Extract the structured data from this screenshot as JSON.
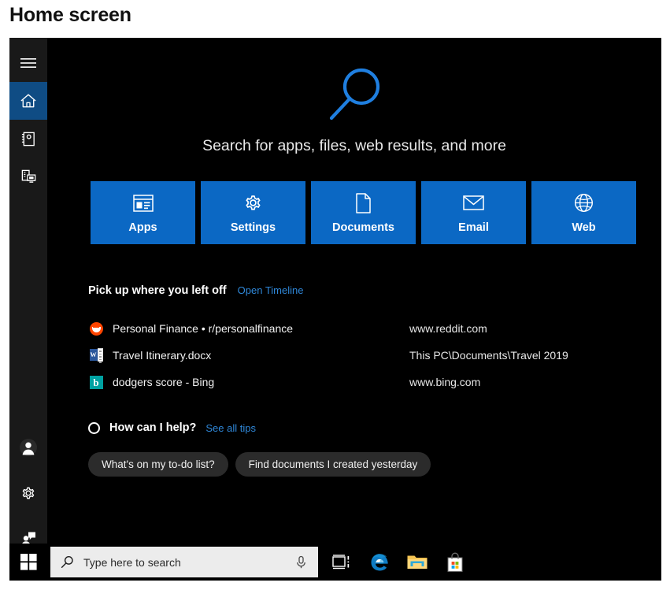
{
  "page": {
    "heading": "Home screen"
  },
  "rail": {
    "top_items": [
      {
        "name": "hamburger-menu",
        "label": "Menu",
        "active": false
      },
      {
        "name": "home",
        "label": "Home",
        "active": true
      },
      {
        "name": "notebook",
        "label": "Notebook",
        "active": false
      },
      {
        "name": "devices",
        "label": "Devices",
        "active": false
      }
    ],
    "bottom_items": [
      {
        "name": "account",
        "label": "Account"
      },
      {
        "name": "settings",
        "label": "Settings"
      },
      {
        "name": "feedback",
        "label": "Feedback"
      }
    ]
  },
  "hero": {
    "icon": "search-magnifier-icon",
    "tagline": "Search for apps, files, web results, and more",
    "accent_color": "#1f7fe0"
  },
  "tiles": [
    {
      "label": "Apps",
      "icon": "apps-window-icon"
    },
    {
      "label": "Settings",
      "icon": "gear-icon"
    },
    {
      "label": "Documents",
      "icon": "document-page-icon"
    },
    {
      "label": "Email",
      "icon": "envelope-icon"
    },
    {
      "label": "Web",
      "icon": "globe-icon"
    }
  ],
  "tile_color": "#0b68c4",
  "timeline": {
    "title": "Pick up where you left off",
    "link": "Open Timeline",
    "items": [
      {
        "icon": "reddit-icon",
        "title": "Personal Finance • r/personalfinance",
        "source": "www.reddit.com"
      },
      {
        "icon": "word-doc-icon",
        "title": "Travel Itinerary.docx",
        "source": "This PC\\Documents\\Travel 2019"
      },
      {
        "icon": "bing-icon",
        "title": "dodgers score - Bing",
        "source": "www.bing.com"
      }
    ]
  },
  "help": {
    "icon": "cortana-ring-icon",
    "title": "How can I help?",
    "link": "See all tips",
    "suggestions": [
      "What's on my to-do list?",
      "Find documents I created yesterday"
    ]
  },
  "taskbar": {
    "start_label": "Start",
    "search_placeholder": "Type here to search",
    "search_icon": "search-icon",
    "mic_icon": "microphone-icon",
    "items": [
      {
        "name": "task-view",
        "label": "Task View"
      },
      {
        "name": "edge",
        "label": "Microsoft Edge"
      },
      {
        "name": "file-explorer",
        "label": "File Explorer"
      },
      {
        "name": "microsoft-store",
        "label": "Microsoft Store"
      }
    ]
  }
}
